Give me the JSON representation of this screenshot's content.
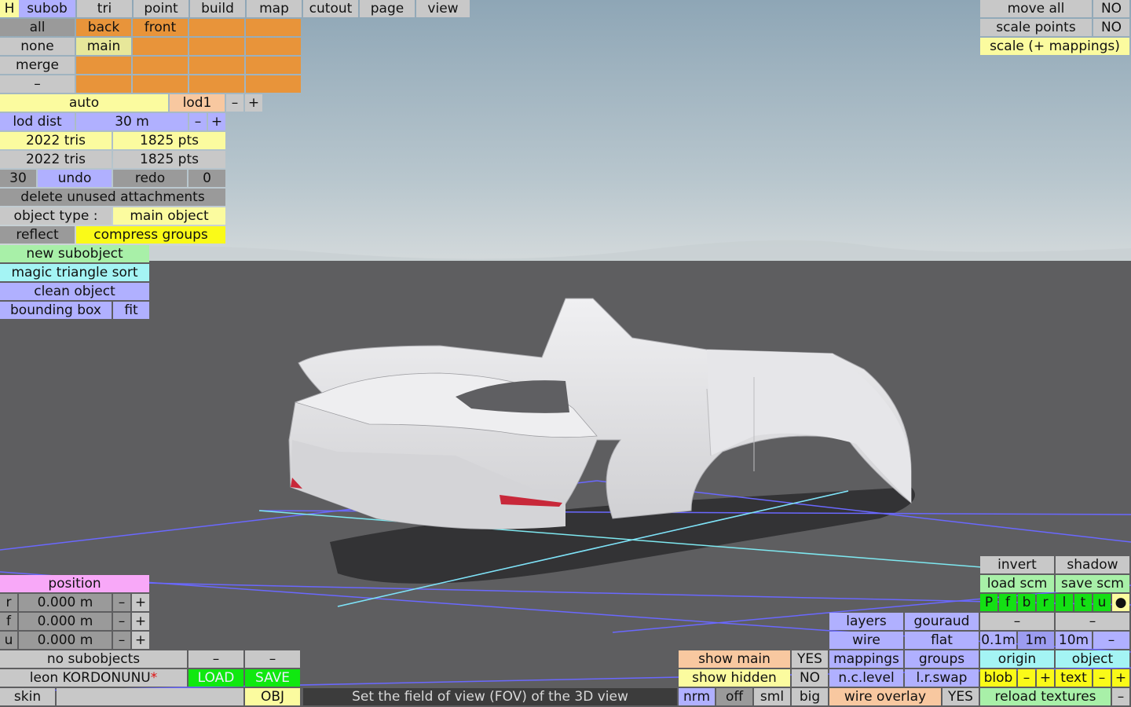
{
  "top_tabs": [
    "H",
    "subob",
    "tri",
    "point",
    "build",
    "map",
    "cutout",
    "page",
    "view"
  ],
  "left_rows": {
    "all": "all",
    "back": "back",
    "front": "front",
    "none": "none",
    "main": "main",
    "merge": "merge",
    "dash": "–",
    "auto": "auto",
    "lod": "lod1",
    "minus": "–",
    "plus": "+",
    "lod_dist_label": "lod dist",
    "lod_dist_value": "30 m",
    "tris1": "2022 tris",
    "pts1": "1825 pts",
    "tris2": "2022 tris",
    "pts2": "1825 pts",
    "undo_count": "30",
    "undo": "undo",
    "redo": "redo",
    "redo_count": "0",
    "delete_unused": "delete unused attachments",
    "object_type_label": "object type :",
    "object_type_value": "main object",
    "reflect": "reflect",
    "compress_groups": "compress groups",
    "new_subobject": "new subobject",
    "magic_triangle_sort": "magic triangle sort",
    "clean_object": "clean object",
    "bounding_box": "bounding box",
    "fit": "fit"
  },
  "top_right": {
    "move_all": "move all",
    "move_all_value": "NO",
    "scale_points": "scale points",
    "scale_points_value": "NO",
    "scale_mappings": "scale (+ mappings)"
  },
  "position": {
    "title": "position",
    "rows": [
      {
        "axis": "r",
        "value": "0.000 m"
      },
      {
        "axis": "f",
        "value": "0.000 m"
      },
      {
        "axis": "u",
        "value": "0.000 m"
      }
    ]
  },
  "bottom_left": {
    "no_subobjects": "no subobjects",
    "file_name": "leon KORDONUNU",
    "load": "LOAD",
    "save": "SAVE",
    "skin": "skin",
    "obj": "OBJ"
  },
  "status_text": "Set the field of view (FOV) of the 3D view",
  "bottom_center": {
    "show_main": "show main",
    "show_main_value": "YES",
    "show_hidden": "show hidden",
    "show_hidden_value": "NO",
    "nrm": "nrm",
    "off": "off",
    "sml": "sml",
    "big": "big"
  },
  "bottom_mid_right": {
    "layers": "layers",
    "gouraud": "gouraud",
    "wire": "wire",
    "flat": "flat",
    "mappings": "mappings",
    "groups": "groups",
    "nc_level": "n.c.level",
    "lr_swap": "l.r.swap",
    "wire_overlay": "wire overlay",
    "wire_overlay_value": "YES"
  },
  "bottom_right": {
    "invert": "invert",
    "shadow": "shadow",
    "load_scm": "load scm",
    "save_scm": "save scm",
    "views": [
      "P",
      "f",
      "b",
      "r",
      "l",
      "t",
      "u",
      "●"
    ],
    "dash": "–",
    "steps": [
      "0.1m",
      "1m",
      "10m"
    ],
    "origin": "origin",
    "object": "object",
    "blob": "blob",
    "text": "text",
    "reload_textures": "reload textures"
  },
  "colors": {
    "sky_top": "#8fa6b5",
    "sky_bottom": "#cfd7da",
    "ground": "#5e5e60",
    "car_body": "#e3e3e5",
    "grid_line": "#6a68ff",
    "axis_line": "#7ee8f0"
  }
}
